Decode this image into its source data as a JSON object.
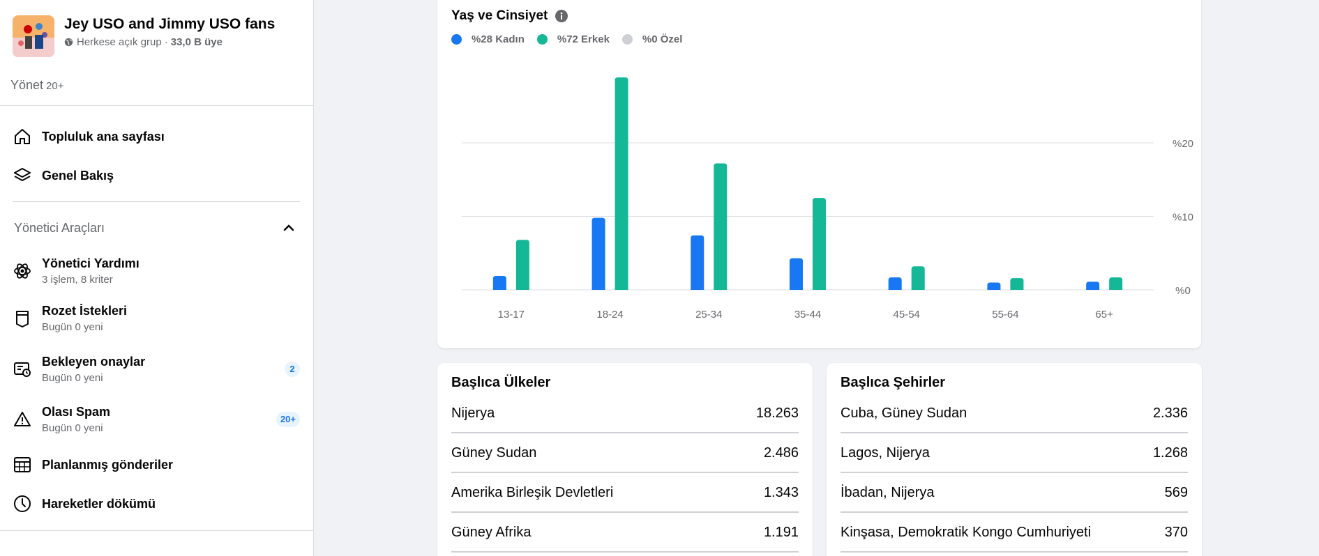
{
  "group": {
    "name": "Jey USO and Jimmy USO fans",
    "privacy": "Herkese açık grup",
    "separator": "·",
    "members": "33,0 B üye"
  },
  "manage": {
    "label": "Yönet",
    "count": "20+"
  },
  "nav_top": [
    {
      "label": "Topluluk ana sayfası",
      "icon": "home-icon"
    },
    {
      "label": "Genel Bakış",
      "icon": "layers-icon"
    }
  ],
  "admin_tools": {
    "title": "Yönetici Araçları",
    "items": [
      {
        "label": "Yönetici Yardımı",
        "sub": "3 işlem, 8 kriter",
        "icon": "gear-atom-icon",
        "badge": ""
      },
      {
        "label": "Rozet İstekleri",
        "sub": "Bugün 0 yeni",
        "icon": "badge-icon",
        "badge": ""
      },
      {
        "label": "Bekleyen onaylar",
        "sub": "Bugün 0 yeni",
        "icon": "pending-icon",
        "badge": "2"
      },
      {
        "label": "Olası Spam",
        "sub": "Bugün 0 yeni",
        "icon": "warning-icon",
        "badge": "20+"
      },
      {
        "label": "Planlanmış gönderiler",
        "sub": "",
        "icon": "calendar-icon",
        "badge": ""
      },
      {
        "label": "Hareketler dökümü",
        "sub": "",
        "icon": "clock-icon",
        "badge": ""
      }
    ]
  },
  "colors": {
    "female": "#1877f2",
    "male": "#14b896",
    "other": "#ced0d4"
  },
  "chart_data": {
    "type": "bar",
    "title": "Yaş ve Cinsiyet",
    "legend": [
      {
        "label": "%28 Kadın"
      },
      {
        "label": "%72 Erkek"
      },
      {
        "label": "%0 Özel"
      }
    ],
    "categories": [
      "13-17",
      "18-24",
      "25-34",
      "35-44",
      "45-54",
      "55-64",
      "65+"
    ],
    "series": [
      {
        "name": "Kadın",
        "values": [
          1.9,
          9.8,
          7.4,
          4.3,
          1.7,
          1.0,
          1.1
        ]
      },
      {
        "name": "Erkek",
        "values": [
          6.8,
          28.9,
          17.2,
          12.5,
          3.2,
          1.6,
          1.7
        ]
      }
    ],
    "yticks": [
      "%0",
      "%10",
      "%20"
    ],
    "ytick_values": [
      0,
      10,
      20
    ],
    "ylim": [
      0,
      30
    ],
    "grid": true,
    "y_axis_position": "right"
  },
  "countries": {
    "title": "Başlıca Ülkeler",
    "rows": [
      {
        "name": "Nijerya",
        "value": "18.263"
      },
      {
        "name": "Güney Sudan",
        "value": "2.486"
      },
      {
        "name": "Amerika Birleşik Devletleri",
        "value": "1.343"
      },
      {
        "name": "Güney Afrika",
        "value": "1.191"
      }
    ]
  },
  "cities": {
    "title": "Başlıca Şehirler",
    "rows": [
      {
        "name": "Cuba, Güney Sudan",
        "value": "2.336"
      },
      {
        "name": "Lagos, Nijerya",
        "value": "1.268"
      },
      {
        "name": "İbadan, Nijerya",
        "value": "569"
      },
      {
        "name": "Kinşasa, Demokratik Kongo Cumhuriyeti",
        "value": "370"
      }
    ]
  }
}
